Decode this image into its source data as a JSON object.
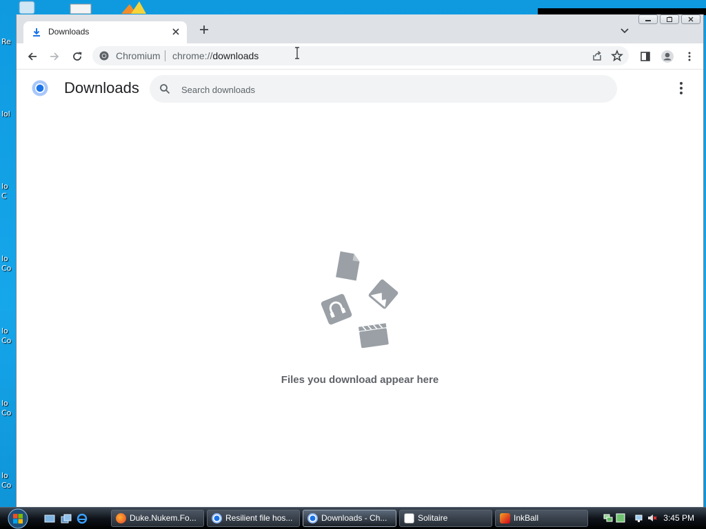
{
  "desktop": {
    "icon_labels": [
      "Re",
      "lol",
      "lo\nC",
      "lo\nCo",
      "lo\nCo",
      "lo\nCo",
      "lo\nCo"
    ]
  },
  "browser": {
    "tab": {
      "title": "Downloads"
    },
    "omnibox": {
      "chip": "Chromium",
      "url_prefix": "chrome://",
      "url_host": "downloads"
    }
  },
  "page": {
    "title": "Downloads",
    "search_placeholder": "Search downloads",
    "empty_message": "Files you download appear here"
  },
  "taskbar": {
    "tasks": [
      {
        "label": "Duke.Nukem.Fo...",
        "icon": "firefox-icon"
      },
      {
        "label": "Resilient file hos...",
        "icon": "chromium-icon"
      },
      {
        "label": "Downloads - Ch...",
        "icon": "chromium-icon",
        "active": true
      },
      {
        "label": "Solitaire",
        "icon": "solitaire-icon"
      },
      {
        "label": "InkBall",
        "icon": "inkball-icon"
      }
    ],
    "clock": "3:45 PM"
  },
  "colors": {
    "accent_blue": "#1a73e8",
    "tabstrip_bg": "#dee1e6",
    "illustration_gray": "#9aa0a6",
    "desktop_bg": "#16a6ea"
  }
}
